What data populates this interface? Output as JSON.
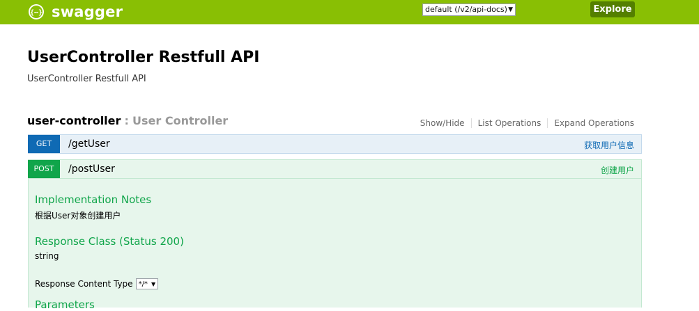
{
  "header": {
    "brand_name": "swagger",
    "logo_glyph": "{⋯}",
    "spec_select": {
      "value": "default (/v2/api-docs)"
    },
    "explore_label": "Explore",
    "colors": {
      "topbar": "#89bf04",
      "explore": "#547f00"
    }
  },
  "info": {
    "title": "UserController Restfull API",
    "description": "UserController Restfull API"
  },
  "resource": {
    "name": "user-controller",
    "separator": ":",
    "description": "User Controller",
    "links": [
      "Show/Hide",
      "List Operations",
      "Expand Operations"
    ]
  },
  "operations": [
    {
      "method": "GET",
      "path": "/getUser",
      "summary": "获取用户信息",
      "color": "#0f6ab4"
    },
    {
      "method": "POST",
      "path": "/postUser",
      "summary": "创建用户",
      "color": "#10a54a",
      "details": {
        "impl_notes_title": "Implementation Notes",
        "impl_notes_text": "根据User对象创建用户",
        "response_class_title": "Response Class (Status 200)",
        "response_class_text": "string",
        "response_content_type_label": "Response Content Type",
        "response_content_type_value": "*/*",
        "parameters_title": "Parameters"
      }
    }
  ]
}
